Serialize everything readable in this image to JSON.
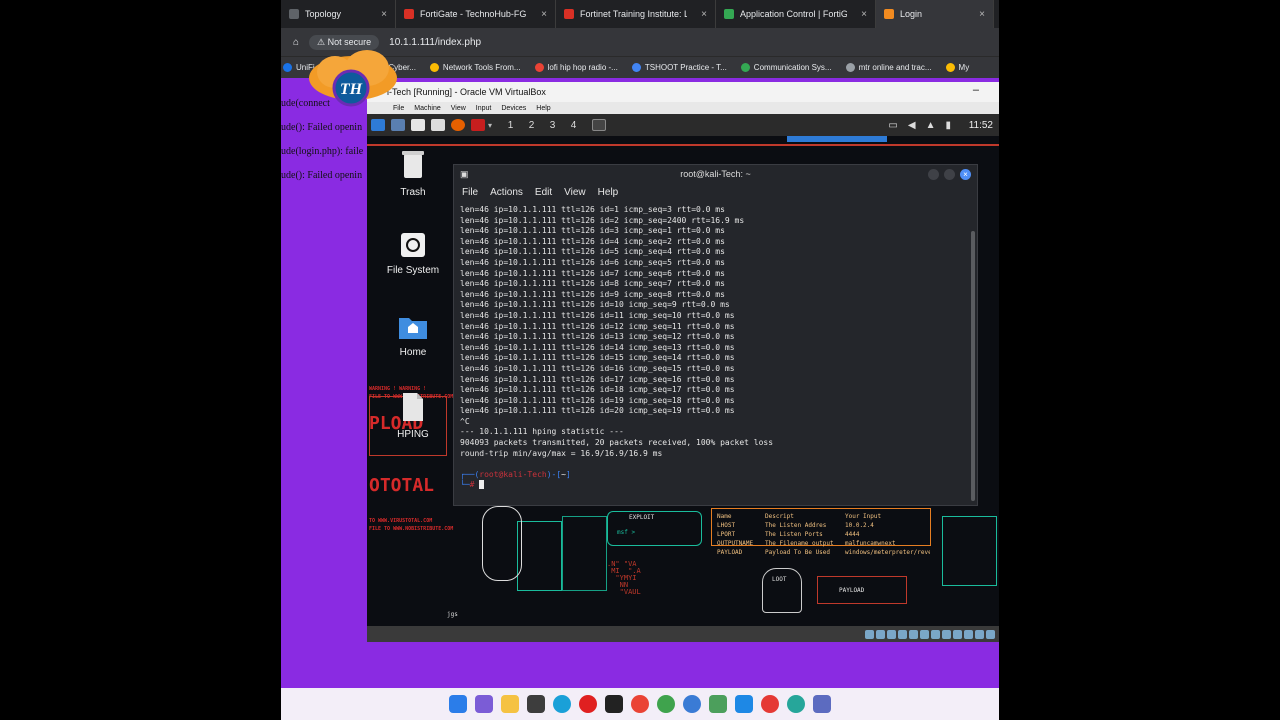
{
  "browser": {
    "tabs": [
      {
        "label": "Topology",
        "color": "#5f6368",
        "active": false
      },
      {
        "label": "FortiGate - TechnoHub-FG",
        "color": "#d93025",
        "active": false
      },
      {
        "label": "Fortinet Training Institute: Log",
        "color": "#d93025",
        "active": false
      },
      {
        "label": "Application Control | FortiGuard",
        "color": "#34a853",
        "active": false
      },
      {
        "label": "Login",
        "color": "#f28b20",
        "active": true
      }
    ],
    "not_secure": "Not secure",
    "url": "10.1.1.111/index.php",
    "bookmarks": [
      {
        "label": "UniFi",
        "color": "#1a73e8"
      },
      {
        "label": "Cisco CCNA Cyber...",
        "color": "#1a73e8"
      },
      {
        "label": "Network Tools From...",
        "color": "#fbbc04"
      },
      {
        "label": "lofi hip hop radio -...",
        "color": "#ea4335"
      },
      {
        "label": "TSHOOT Practice - T...",
        "color": "#4285f4"
      },
      {
        "label": "Communication Sys...",
        "color": "#34a853"
      },
      {
        "label": "mtr online and trac...",
        "color": "#9aa0a6"
      },
      {
        "label": "My",
        "color": "#fbbc04"
      }
    ]
  },
  "logo": {
    "text": "TH"
  },
  "web_errors": [
    "ude(connect",
    "ude(): Failed openin",
    "ude(login.php): faile",
    "ude(): Failed openin"
  ],
  "vbox": {
    "title": "i-Tech [Running] - Oracle VM VirtualBox",
    "menu": [
      "File",
      "Machine",
      "View",
      "Input",
      "Devices",
      "Help"
    ],
    "minimize": "–"
  },
  "kali": {
    "workspaces": [
      "1",
      "2",
      "3",
      "4"
    ],
    "clock": "11:52",
    "desktop_icons": [
      {
        "label": "Trash",
        "icon": "trash-icon"
      },
      {
        "label": "File System",
        "icon": "filesystem-icon"
      },
      {
        "label": "Home",
        "icon": "home-folder-icon"
      },
      {
        "label": "HPING",
        "icon": "document-icon"
      }
    ]
  },
  "terminal": {
    "title": "root@kali-Tech: ~",
    "menu": [
      "File",
      "Actions",
      "Edit",
      "View",
      "Help"
    ],
    "lines": [
      "len=46 ip=10.1.1.111 ttl=126 id=1 icmp_seq=3 rtt=0.0 ms",
      "len=46 ip=10.1.1.111 ttl=126 id=2 icmp_seq=2400 rtt=16.9 ms",
      "len=46 ip=10.1.1.111 ttl=126 id=3 icmp_seq=1 rtt=0.0 ms",
      "len=46 ip=10.1.1.111 ttl=126 id=4 icmp_seq=2 rtt=0.0 ms",
      "len=46 ip=10.1.1.111 ttl=126 id=5 icmp_seq=4 rtt=0.0 ms",
      "len=46 ip=10.1.1.111 ttl=126 id=6 icmp_seq=5 rtt=0.0 ms",
      "len=46 ip=10.1.1.111 ttl=126 id=7 icmp_seq=6 rtt=0.0 ms",
      "len=46 ip=10.1.1.111 ttl=126 id=8 icmp_seq=7 rtt=0.0 ms",
      "len=46 ip=10.1.1.111 ttl=126 id=9 icmp_seq=8 rtt=0.0 ms",
      "len=46 ip=10.1.1.111 ttl=126 id=10 icmp_seq=9 rtt=0.0 ms",
      "len=46 ip=10.1.1.111 ttl=126 id=11 icmp_seq=10 rtt=0.0 ms",
      "len=46 ip=10.1.1.111 ttl=126 id=12 icmp_seq=11 rtt=0.0 ms",
      "len=46 ip=10.1.1.111 ttl=126 id=13 icmp_seq=12 rtt=0.0 ms",
      "len=46 ip=10.1.1.111 ttl=126 id=14 icmp_seq=13 rtt=0.0 ms",
      "len=46 ip=10.1.1.111 ttl=126 id=15 icmp_seq=14 rtt=0.0 ms",
      "len=46 ip=10.1.1.111 ttl=126 id=16 icmp_seq=15 rtt=0.0 ms",
      "len=46 ip=10.1.1.111 ttl=126 id=17 icmp_seq=16 rtt=0.0 ms",
      "len=46 ip=10.1.1.111 ttl=126 id=18 icmp_seq=17 rtt=0.0 ms",
      "len=46 ip=10.1.1.111 ttl=126 id=19 icmp_seq=18 rtt=0.0 ms",
      "len=46 ip=10.1.1.111 ttl=126 id=20 icmp_seq=19 rtt=0.0 ms",
      "^C",
      "--- 10.1.1.111 hping statistic ---",
      "904093 packets transmitted, 20 packets received, 100% packet loss",
      "round-trip min/avg/max = 16.9/16.9/16.9 ms"
    ],
    "prompt_user": "root@kali-Tech",
    "prompt_dir": "~",
    "prompt_symbol": "#"
  },
  "wallpaper": {
    "exploit_label": "EXPLOIT",
    "msf_label": "msf >",
    "loot_label": "LOOT",
    "payload_label": "PAYLOAD",
    "table_header": [
      "Name",
      "Descript",
      "Your Input"
    ],
    "table_rows": [
      [
        "LHOST",
        "The Listen Addres",
        "10.0.2.4"
      ],
      [
        "LPORT",
        "The Listen Ports",
        "4444"
      ],
      [
        "OUTPUTNAME",
        "The Filename output",
        "malfuncamwnext"
      ],
      [
        "PAYLOAD",
        "Payload To Be Used",
        "windows/meterpreter/rever"
      ]
    ],
    "left_text": [
      "WARNING ! WARNING !",
      "FILE TO WWW.NOBISTRIBUTE.COM",
      "PLOAD",
      "OTOTAL",
      "TO WWW.VIRUSTOTAL.COM",
      "FILE TO WWW.NOBISTRIBUTE.COM"
    ],
    "jgs": "jgs"
  }
}
